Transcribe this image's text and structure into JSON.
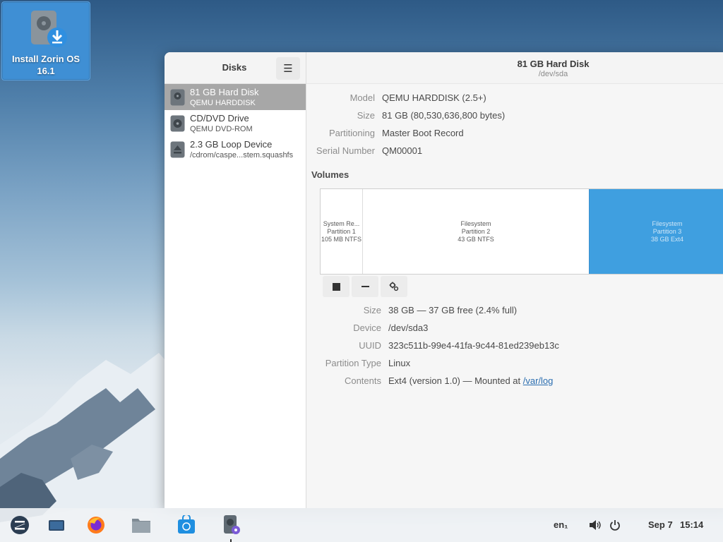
{
  "desktop": {
    "install_icon_label_line1": "Install Zorin OS",
    "install_icon_label_line2": "16.1"
  },
  "sidebar": {
    "title": "Disks",
    "menu_icon": "hamburger-icon",
    "items": [
      {
        "name": "81 GB Hard Disk",
        "sub": "QEMU HARDDISK",
        "icon": "hard-disk-icon",
        "selected": true
      },
      {
        "name": "CD/DVD Drive",
        "sub": "QEMU DVD-ROM",
        "icon": "optical-drive-icon",
        "selected": false
      },
      {
        "name": "2.3 GB Loop Device",
        "sub": "/cdrom/caspe...stem.squashfs",
        "icon": "eject-icon",
        "selected": false
      }
    ]
  },
  "header": {
    "title": "81 GB Hard Disk",
    "subtitle": "/dev/sda",
    "menu_icon": "kebab-menu-icon"
  },
  "drive": {
    "model_label": "Model",
    "model": "QEMU HARDDISK (2.5+)",
    "size_label": "Size",
    "size": "81 GB (80,530,636,800 bytes)",
    "partitioning_label": "Partitioning",
    "partitioning": "Master Boot Record",
    "serial_label": "Serial Number",
    "serial": "QM00001"
  },
  "volumes": {
    "heading": "Volumes",
    "partitions": [
      {
        "line1": "System Re...",
        "line2": "Partition 1",
        "line3": "105 MB NTFS"
      },
      {
        "line1": "Filesystem",
        "line2": "Partition 2",
        "line3": "43 GB NTFS"
      },
      {
        "line1": "Filesystem",
        "line2": "Partition 3",
        "line3": "38 GB Ext4"
      }
    ],
    "buttons": [
      "stop-icon",
      "minus-icon",
      "gears-icon"
    ]
  },
  "selected_volume": {
    "size_label": "Size",
    "size": "38 GB — 37 GB free (2.4% full)",
    "device_label": "Device",
    "device": "/dev/sda3",
    "uuid_label": "UUID",
    "uuid": "323c511b-99e4-41fa-9c44-81ed239eb13c",
    "ptype_label": "Partition Type",
    "ptype": "Linux",
    "contents_label": "Contents",
    "contents": "Ext4 (version 1.0) — Mounted at ",
    "mount_link": "/var/log"
  },
  "taskbar": {
    "apps": [
      "zorin-menu-icon",
      "workspaces-icon",
      "firefox-icon",
      "files-icon",
      "software-store-icon",
      "disks-icon"
    ],
    "keyboard_layout": "en₁",
    "volume_icon": "volume-icon",
    "power_icon": "power-icon",
    "date": "Sep 7",
    "time": "15:14"
  },
  "colors": {
    "selection": "#a7a7a7",
    "partition_selected": "#3f9fe0",
    "desktop_icon_bg": "#3f8fd4",
    "link": "#2a6db0"
  }
}
